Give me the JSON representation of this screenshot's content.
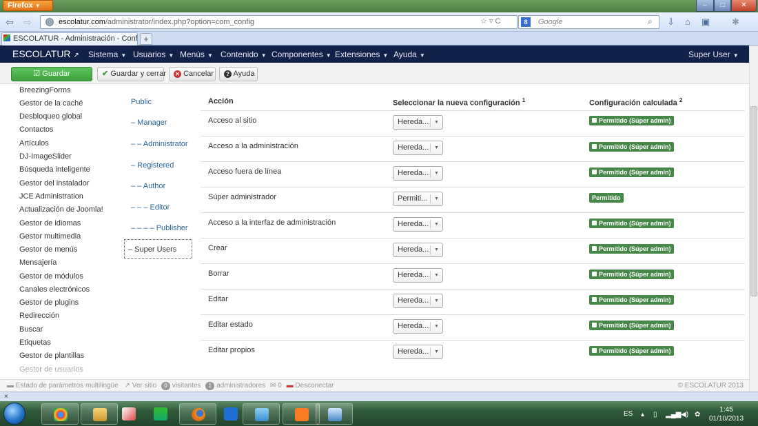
{
  "browser": {
    "app_button": "Firefox",
    "url_domain": "escolatur.com",
    "url_path": "/administrator/index.php?option=com_config",
    "search_placeholder": "Google",
    "search_engine_label": "8",
    "tab_title": "ESCOLATUR - Administración - Configu...",
    "new_tab_label": "+",
    "bottom_close": "×"
  },
  "joomla_nav": {
    "brand": "ESCOLATUR",
    "menus": [
      "Sistema",
      "Usuarios",
      "Menús",
      "Contenido",
      "Componentes",
      "Extensiones",
      "Ayuda"
    ],
    "user": "Super User"
  },
  "toolbar": {
    "save": "Guardar",
    "save_close": "Guardar y cerrar",
    "cancel": "Cancelar",
    "help": "Ayuda"
  },
  "components": [
    "BreezingForms",
    "Gestor de la caché",
    "Desbloqueo global",
    "Contactos",
    "Artículos",
    "DJ-ImageSlider",
    "Búsqueda inteligente",
    "Gestor del instalador",
    "JCE Administration",
    "Actualización de Joomla!",
    "Gestor de idiomas",
    "Gestor multimedia",
    "Gestor de menús",
    "Mensajería",
    "Gestor de módulos",
    "Canales electrónicos",
    "Gestor de plugins",
    "Redirección",
    "Buscar",
    "Etiquetas",
    "Gestor de plantillas",
    "Gestor de usuarios"
  ],
  "groups": [
    "Public",
    "– Manager",
    "– – Administrator",
    "– Registered",
    "– – Author",
    "– – – Editor",
    "– – – – Publisher",
    "– Super Users"
  ],
  "table": {
    "col_action": "Acción",
    "col_new": "Seleccionar la nueva configuración",
    "col_new_sup": "1",
    "col_calc": "Configuración calculada",
    "col_calc_sup": "2",
    "rows": [
      {
        "action": "Acceso al sitio",
        "select": "Hereda...",
        "badge": "Permitido (Súper admin)"
      },
      {
        "action": "Acceso a la administración",
        "select": "Hereda...",
        "badge": "Permitido (Súper admin)"
      },
      {
        "action": "Acceso fuera de línea",
        "select": "Hereda...",
        "badge": "Permitido (Súper admin)"
      },
      {
        "action": "Súper administrador",
        "select": "Permiti...",
        "badge": "Permitido"
      },
      {
        "action": "Acceso a la interfaz de administración",
        "select": "Hereda...",
        "badge": "Permitido (Súper admin)"
      },
      {
        "action": "Crear",
        "select": "Hereda...",
        "badge": "Permitido (Súper admin)"
      },
      {
        "action": "Borrar",
        "select": "Hereda...",
        "badge": "Permitido (Súper admin)"
      },
      {
        "action": "Editar",
        "select": "Hereda...",
        "badge": "Permitido (Súper admin)"
      },
      {
        "action": "Editar estado",
        "select": "Hereda...",
        "badge": "Permitido (Súper admin)"
      },
      {
        "action": "Editar propios",
        "select": "Hereda...",
        "badge": "Permitido (Súper admin)"
      }
    ]
  },
  "status": {
    "multilang": "Estado de parámetros multilingüe",
    "view_site": "Ver sitio",
    "visitors_count": "0",
    "visitors": "visitantes",
    "admins_count": "1",
    "admins": "administradores",
    "messages": "0",
    "logout": "Desconectar",
    "copyright": "© ESCOLATUR 2013"
  },
  "system_tray": {
    "lang": "ES",
    "time": "1:45",
    "date": "01/10/2013"
  },
  "colors": {
    "joomla_nav": "#12214a",
    "save_green": "#46a546",
    "badge_green": "#468847",
    "link_blue": "#2a6496"
  }
}
